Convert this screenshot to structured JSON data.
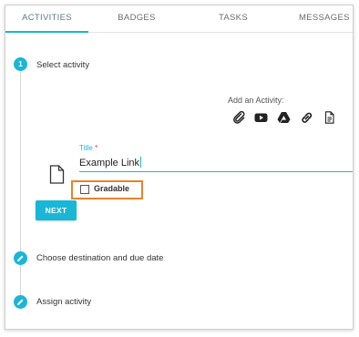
{
  "tabs": [
    {
      "label": "ACTIVITIES",
      "active": true
    },
    {
      "label": "BADGES",
      "active": false
    },
    {
      "label": "TASKS",
      "active": false
    },
    {
      "label": "MESSAGES",
      "active": false
    }
  ],
  "steps": {
    "step1": {
      "number": "1",
      "label": "Select activity"
    },
    "step2": {
      "label": "Choose destination and due date",
      "icon": "pencil-icon"
    },
    "step3": {
      "label": "Assign activity",
      "icon": "pencil-icon"
    }
  },
  "add_activity": {
    "label": "Add an Activity:",
    "icons": [
      "paperclip-icon",
      "youtube-icon",
      "google-drive-icon",
      "link-icon",
      "document-icon"
    ]
  },
  "form": {
    "title_label": "Title",
    "required_mark": "*",
    "title_value": "Example Link",
    "gradable_label": "Gradable",
    "gradable_checked": false,
    "next_label": "NEXT"
  },
  "colors": {
    "accent": "#1ab6d6",
    "highlight": "#e8822b",
    "required": "#e53935"
  }
}
